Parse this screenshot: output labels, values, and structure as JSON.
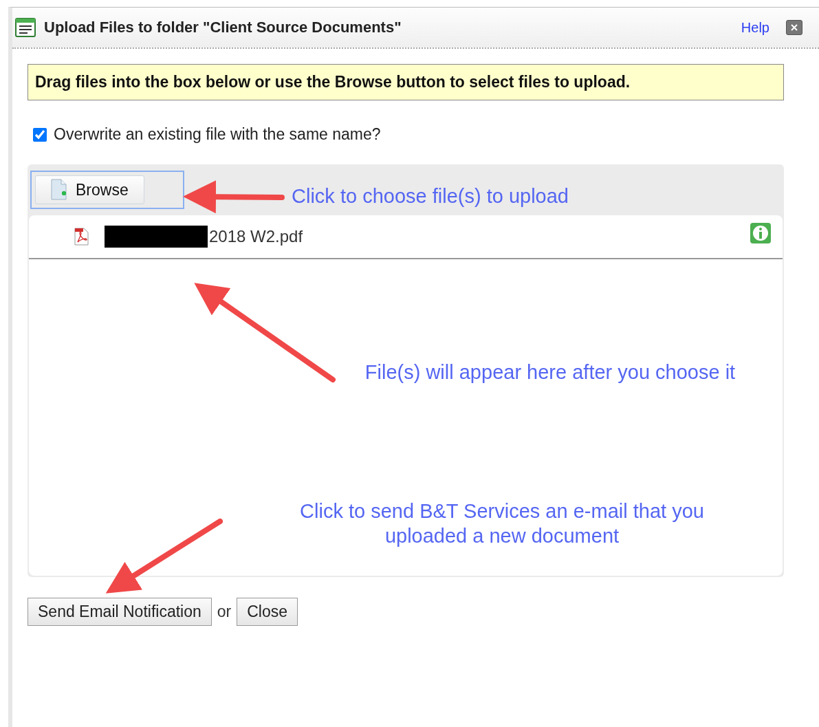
{
  "dialog": {
    "title": "Upload Files to folder \"Client Source Documents\"",
    "help_link": "Help"
  },
  "instructions": "Drag files into the box below or use the Browse button to select files to upload.",
  "overwrite": {
    "label": "Overwrite an existing file with the same name?",
    "checked": true
  },
  "browse_button": "Browse",
  "files": [
    {
      "name": "2018 W2.pdf",
      "redacted": true
    }
  ],
  "annotations": [
    {
      "text": "Click to choose file(s) to upload"
    },
    {
      "text": "File(s) will appear here after you choose it"
    },
    {
      "text": "Click to send B&T Services an e-mail that you uploaded a new document"
    }
  ],
  "actions": {
    "send_button": "Send Email Notification",
    "separator": "or",
    "close_button": "Close"
  }
}
